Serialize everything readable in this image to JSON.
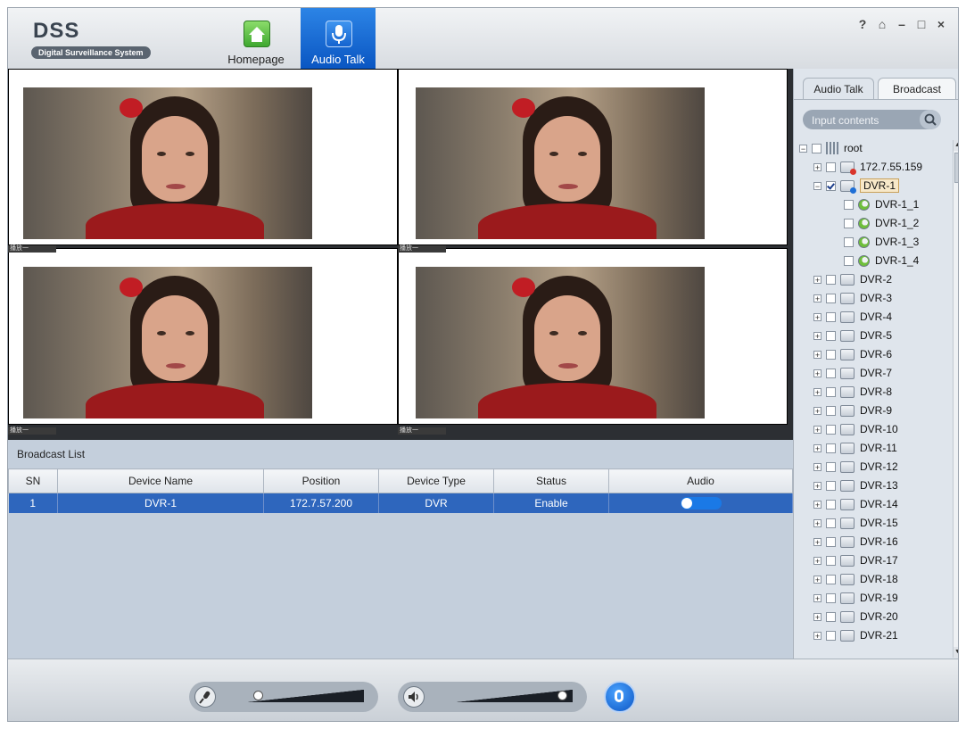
{
  "app": {
    "logo": "DSS",
    "subtitle": "Digital Surveillance System"
  },
  "nav": [
    {
      "label": "Homepage",
      "icon": "home-icon",
      "active": false
    },
    {
      "label": "Audio Talk",
      "icon": "microphone-icon",
      "active": true
    }
  ],
  "window_controls": [
    "?",
    "⌂",
    "–",
    "□",
    "×"
  ],
  "video": {
    "tags": [
      "播放一",
      "播放一",
      "播放一",
      "播放一"
    ]
  },
  "broadcast": {
    "title": "Broadcast List",
    "columns": [
      "SN",
      "Device Name",
      "Position",
      "Device Type",
      "Status",
      "Audio"
    ],
    "rows": [
      {
        "sn": "1",
        "name": "DVR-1",
        "position": "172.7.57.200",
        "type": "DVR",
        "status": "Enable",
        "audio_on": true
      }
    ]
  },
  "panel": {
    "tabs": [
      "Audio Talk",
      "Broadcast"
    ],
    "active_tab": "Broadcast",
    "search_placeholder": "Input contents",
    "tree": [
      {
        "label": "root",
        "level": 0,
        "expander": "−",
        "checked": false,
        "icon": "root"
      },
      {
        "label": "172.7.55.159",
        "level": 1,
        "expander": "+",
        "checked": false,
        "icon": "dev-warn"
      },
      {
        "label": "DVR-1",
        "level": 1,
        "expander": "−",
        "checked": true,
        "icon": "dev-blue",
        "selected": true
      },
      {
        "label": "DVR-1_1",
        "level": 2,
        "expander": "",
        "checked": false,
        "icon": "channel"
      },
      {
        "label": "DVR-1_2",
        "level": 2,
        "expander": "",
        "checked": false,
        "icon": "channel"
      },
      {
        "label": "DVR-1_3",
        "level": 2,
        "expander": "",
        "checked": false,
        "icon": "channel"
      },
      {
        "label": "DVR-1_4",
        "level": 2,
        "expander": "",
        "checked": false,
        "icon": "channel"
      },
      {
        "label": "DVR-2",
        "level": 1,
        "expander": "+",
        "checked": false,
        "icon": "dev"
      },
      {
        "label": "DVR-3",
        "level": 1,
        "expander": "+",
        "checked": false,
        "icon": "dev"
      },
      {
        "label": "DVR-4",
        "level": 1,
        "expander": "+",
        "checked": false,
        "icon": "dev"
      },
      {
        "label": "DVR-5",
        "level": 1,
        "expander": "+",
        "checked": false,
        "icon": "dev"
      },
      {
        "label": "DVR-6",
        "level": 1,
        "expander": "+",
        "checked": false,
        "icon": "dev"
      },
      {
        "label": "DVR-7",
        "level": 1,
        "expander": "+",
        "checked": false,
        "icon": "dev"
      },
      {
        "label": "DVR-8",
        "level": 1,
        "expander": "+",
        "checked": false,
        "icon": "dev"
      },
      {
        "label": "DVR-9",
        "level": 1,
        "expander": "+",
        "checked": false,
        "icon": "dev"
      },
      {
        "label": "DVR-10",
        "level": 1,
        "expander": "+",
        "checked": false,
        "icon": "dev"
      },
      {
        "label": "DVR-11",
        "level": 1,
        "expander": "+",
        "checked": false,
        "icon": "dev"
      },
      {
        "label": "DVR-12",
        "level": 1,
        "expander": "+",
        "checked": false,
        "icon": "dev"
      },
      {
        "label": "DVR-13",
        "level": 1,
        "expander": "+",
        "checked": false,
        "icon": "dev"
      },
      {
        "label": "DVR-14",
        "level": 1,
        "expander": "+",
        "checked": false,
        "icon": "dev"
      },
      {
        "label": "DVR-15",
        "level": 1,
        "expander": "+",
        "checked": false,
        "icon": "dev"
      },
      {
        "label": "DVR-16",
        "level": 1,
        "expander": "+",
        "checked": false,
        "icon": "dev"
      },
      {
        "label": "DVR-17",
        "level": 1,
        "expander": "+",
        "checked": false,
        "icon": "dev"
      },
      {
        "label": "DVR-18",
        "level": 1,
        "expander": "+",
        "checked": false,
        "icon": "dev"
      },
      {
        "label": "DVR-19",
        "level": 1,
        "expander": "+",
        "checked": false,
        "icon": "dev"
      },
      {
        "label": "DVR-20",
        "level": 1,
        "expander": "+",
        "checked": false,
        "icon": "dev"
      },
      {
        "label": "DVR-21",
        "level": 1,
        "expander": "+",
        "checked": false,
        "icon": "dev"
      }
    ]
  },
  "toolbar": {
    "mic_volume": 0.05,
    "speaker_volume": 0.95,
    "mic_icon": "microphone-icon",
    "speaker_icon": "speaker-icon",
    "talk_icon": "talk-icon"
  },
  "colors": {
    "accent": "#0a56c2",
    "selected_row": "#2e66bd",
    "panel": "#dfe5ec"
  }
}
